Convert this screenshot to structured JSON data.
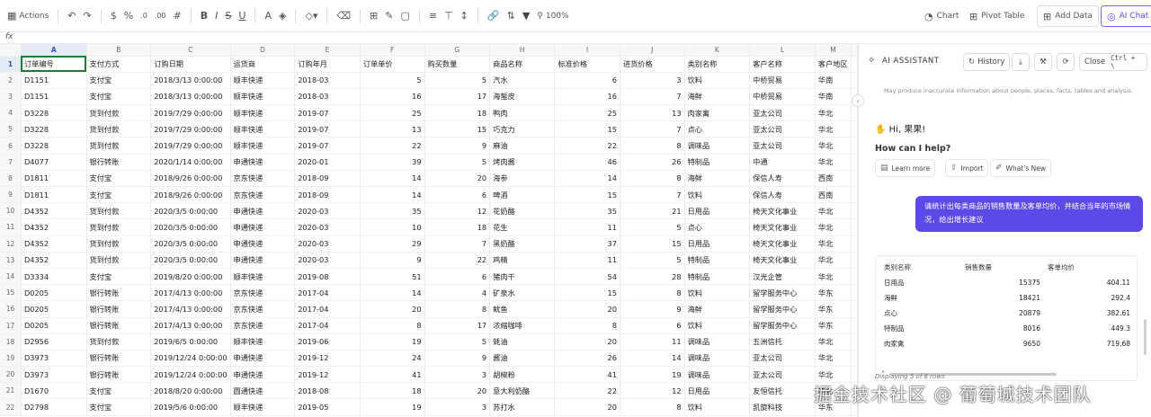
{
  "toolbar": {
    "actions_label": "Actions",
    "zoom": "100%",
    "chart_label": "Chart",
    "pivot_label": "Pivot Table",
    "add_data_label": "Add Data",
    "ai_chat_label": "AI Chat"
  },
  "formula_bar": {
    "fx": "fx"
  },
  "sheet": {
    "columns": [
      "A",
      "B",
      "C",
      "D",
      "E",
      "F",
      "G",
      "H",
      "I",
      "J",
      "K",
      "L",
      "M"
    ],
    "header_row": [
      "订单编号",
      "支付方式",
      "订购日期",
      "运货商",
      "订购年月",
      "订单单价",
      "购买数量",
      "商品名称",
      "标准价格",
      "进货价格",
      "类别名称",
      "客户名称",
      "客户地区"
    ],
    "rows": [
      [
        "D1151",
        "支付宝",
        "2018/3/13 0:00:00",
        "顺丰快递",
        "2018-03",
        "5",
        "5",
        "汽水",
        "6",
        "3",
        "饮料",
        "中桥贸易",
        "华南"
      ],
      [
        "D1151",
        "支付宝",
        "2018/3/13 0:00:00",
        "顺丰快递",
        "2018-03",
        "16",
        "17",
        "海蜇皮",
        "16",
        "7",
        "海鲜",
        "中桥贸易",
        "华南"
      ],
      [
        "D3228",
        "货到付款",
        "2019/7/29 0:00:00",
        "顺丰快递",
        "2019-07",
        "25",
        "18",
        "鸭肉",
        "25",
        "13",
        "肉家禽",
        "亚太公司",
        "华北"
      ],
      [
        "D3228",
        "货到付款",
        "2019/7/29 0:00:00",
        "顺丰快递",
        "2019-07",
        "13",
        "15",
        "巧克力",
        "15",
        "7",
        "点心",
        "亚太公司",
        "华北"
      ],
      [
        "D3228",
        "货到付款",
        "2019/7/29 0:00:00",
        "顺丰快递",
        "2019-07",
        "22",
        "9",
        "麻油",
        "22",
        "8",
        "调味品",
        "亚太公司",
        "华北"
      ],
      [
        "D4077",
        "银行转账",
        "2020/1/14 0:00:00",
        "申通快递",
        "2020-01",
        "39",
        "5",
        "烤肉酱",
        "46",
        "26",
        "特制品",
        "中通",
        "华北"
      ],
      [
        "D1811",
        "支付宝",
        "2018/9/26 0:00:00",
        "京东快递",
        "2018-09",
        "14",
        "20",
        "海参",
        "14",
        "8",
        "海鲜",
        "保信人寿",
        "西南"
      ],
      [
        "D1811",
        "支付宝",
        "2018/9/26 0:00:00",
        "京东快递",
        "2018-09",
        "14",
        "6",
        "啤酒",
        "15",
        "7",
        "饮料",
        "保信人寿",
        "西南"
      ],
      [
        "D4352",
        "货到付款",
        "2020/3/5 0:00:00",
        "申通快递",
        "2020-03",
        "35",
        "12",
        "花奶酪",
        "35",
        "21",
        "日用品",
        "椅天文化事业",
        "华北"
      ],
      [
        "D4352",
        "货到付款",
        "2020/3/5 0:00:00",
        "申通快递",
        "2020-03",
        "10",
        "18",
        "花生",
        "11",
        "5",
        "点心",
        "椅天文化事业",
        "华北"
      ],
      [
        "D4352",
        "货到付款",
        "2020/3/5 0:00:00",
        "申通快递",
        "2020-03",
        "29",
        "7",
        "黑奶酪",
        "37",
        "15",
        "日用品",
        "椅天文化事业",
        "华北"
      ],
      [
        "D4352",
        "货到付款",
        "2020/3/5 0:00:00",
        "申通快递",
        "2020-03",
        "9",
        "22",
        "鸡精",
        "11",
        "5",
        "特制品",
        "椅天文化事业",
        "华北"
      ],
      [
        "D3334",
        "支付宝",
        "2019/8/20 0:00:00",
        "顺丰快递",
        "2019-08",
        "51",
        "6",
        "猪肉干",
        "54",
        "28",
        "特制品",
        "汉光企管",
        "华北"
      ],
      [
        "D0205",
        "银行转账",
        "2017/4/13 0:00:00",
        "京东快递",
        "2017-04",
        "14",
        "4",
        "矿泉水",
        "15",
        "8",
        "饮料",
        "留学服务中心",
        "华东"
      ],
      [
        "D0205",
        "银行转账",
        "2017/4/13 0:00:00",
        "京东快递",
        "2017-04",
        "20",
        "8",
        "鱿鱼",
        "20",
        "9",
        "海鲜",
        "留学服务中心",
        "华东"
      ],
      [
        "D0205",
        "银行转账",
        "2017/4/13 0:00:00",
        "京东快递",
        "2017-04",
        "8",
        "17",
        "浓缩咖啡",
        "8",
        "6",
        "饮料",
        "留学服务中心",
        "华东"
      ],
      [
        "D2956",
        "货到付款",
        "2019/6/5 0:00:00",
        "顺丰快递",
        "2019-06",
        "19",
        "5",
        "蚝油",
        "20",
        "11",
        "调味品",
        "五洲信托",
        "华北"
      ],
      [
        "D3973",
        "银行转账",
        "2019/12/24 0:00:00",
        "申通快递",
        "2019-12",
        "24",
        "9",
        "酱油",
        "26",
        "14",
        "调味品",
        "亚太公司",
        "华北"
      ],
      [
        "D3973",
        "银行转账",
        "2019/12/24 0:00:00",
        "申通快递",
        "2019-12",
        "41",
        "3",
        "胡椒粉",
        "41",
        "19",
        "调味品",
        "亚太公司",
        "华北"
      ],
      [
        "D1670",
        "支付宝",
        "2018/8/20 0:00:00",
        "圆通快递",
        "2018-08",
        "18",
        "20",
        "意大利奶酪",
        "22",
        "12",
        "日用品",
        "友恒信托",
        "华北"
      ],
      [
        "D2798",
        "支付宝",
        "2019/5/6 0:00:00",
        "顺丰快递",
        "2019-05",
        "19",
        "3",
        "苏打水",
        "20",
        "8",
        "饮料",
        "凯旋科技",
        "华东"
      ]
    ]
  },
  "assistant": {
    "title": "AI ASSISTANT",
    "history_label": "History",
    "close_label": "Close",
    "close_shortcut": "Ctrl + \\",
    "disclaimer": "May produce inaccurate information about people, places, facts, tables and analysis.",
    "greeting": "Hi, 果果!",
    "help_prompt": "How can I help?",
    "chips": [
      "Learn more",
      "Import",
      "What's New"
    ],
    "user_message": "请统计出每类商品的销售数量及客单均价，并结合当年的市场情况，给出增长建议",
    "result_headers": [
      "类别名称",
      "销售数量",
      "客单均价"
    ],
    "result_rows": [
      [
        "日用品",
        "15375",
        "404.11"
      ],
      [
        "海鲜",
        "18421",
        "292.4"
      ],
      [
        "点心",
        "20879",
        "382.61"
      ],
      [
        "特制品",
        "8016",
        "449.3"
      ],
      [
        "肉家禽",
        "9650",
        "719.68"
      ]
    ],
    "rows_note": "Displaying 5 of 8 rows"
  },
  "watermark": "掘金技术社区 @ 葡萄城技术团队"
}
